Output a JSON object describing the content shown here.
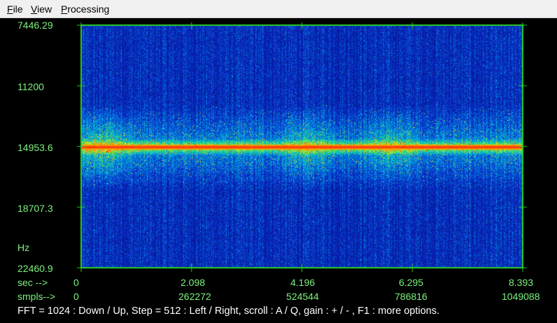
{
  "menu": {
    "items": [
      {
        "label": "File",
        "underline": "F"
      },
      {
        "label": "View",
        "underline": "V"
      },
      {
        "label": "Processing",
        "underline": "P"
      }
    ]
  },
  "spectrogram": {
    "y_axis": {
      "ticks": [
        "7446.29",
        "11200",
        "14953.6",
        "18707.3",
        "22460.9"
      ],
      "unit": "Hz"
    },
    "x_axis": {
      "sec_label": "sec -->",
      "sec_ticks": [
        "0",
        "2.098",
        "4.196",
        "6.295",
        "8.393"
      ],
      "smpls_label": "smpls-->",
      "smpls_ticks": [
        "0",
        "262272",
        "524544",
        "786816",
        "1049088"
      ]
    },
    "status_line": "FFT = 1024 : Down / Up,    Step = 512 : Left / Right,    scroll : A / Q,    gain : + / - ,     F1 : more options."
  },
  "colors": {
    "axis": "#2ad02a",
    "label": "#7cf27c",
    "background_low": "#0a1a8a",
    "hot": "#ff2a00",
    "menubar": "#f0f0f0"
  }
}
